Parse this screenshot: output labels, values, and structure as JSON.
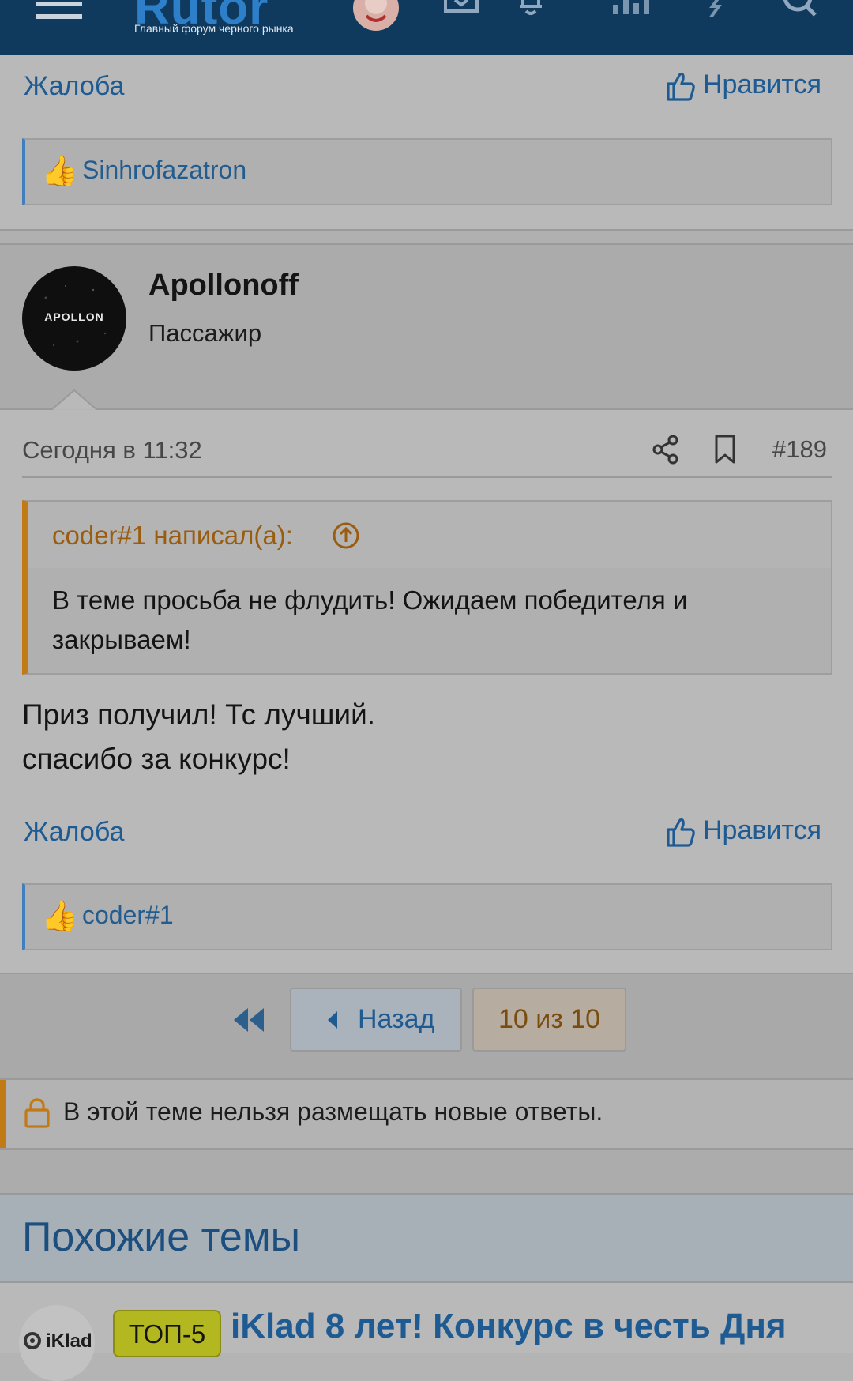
{
  "header": {
    "logo_text": "Rutor",
    "logo_subtitle": "Главный форум черного рынка"
  },
  "prev_post": {
    "report_label": "Жалоба",
    "like_label": "Нравится",
    "reaction_user": "Sinhrofazatron"
  },
  "post": {
    "avatar_text": "APOLLON",
    "username": "Apollonoff",
    "user_title": "Пассажир",
    "time": "Сегодня в 11:32",
    "post_number": "#189",
    "quote": {
      "author_line": "coder#1 написал(а):",
      "text": "В теме просьба не флудить! Ожидаем победителя и закрываем!"
    },
    "body_line1": "Приз получил! Тс лучший.",
    "body_line2": "спасибо за конкурс!",
    "report_label": "Жалоба",
    "like_label": "Нравится",
    "reaction_user": "coder#1"
  },
  "pagination": {
    "back_label": "Назад",
    "page_label": "10 из 10"
  },
  "locked_notice": "В этой теме нельзя размещать новые ответы.",
  "similar": {
    "heading": "Похожие темы",
    "first_item": {
      "avatar_text": "iKlad",
      "tag": "ТОП-5",
      "title": "iKlad 8 лет! Конкурс в честь Дня"
    }
  },
  "colors": {
    "header_bg": "#0f3a5e",
    "link": "#1f5b93",
    "quote_accent": "#c27a16",
    "tag_bg": "#b4b820"
  },
  "icons": [
    "menu-icon",
    "avatar-icon",
    "inbox-icon",
    "bell-icon",
    "stats-icon",
    "lightning-icon",
    "search-icon",
    "thumbs-up-icon",
    "share-icon",
    "bookmark-icon",
    "arrow-up-circle-icon",
    "double-left-icon",
    "caret-left-icon",
    "lock-icon"
  ]
}
